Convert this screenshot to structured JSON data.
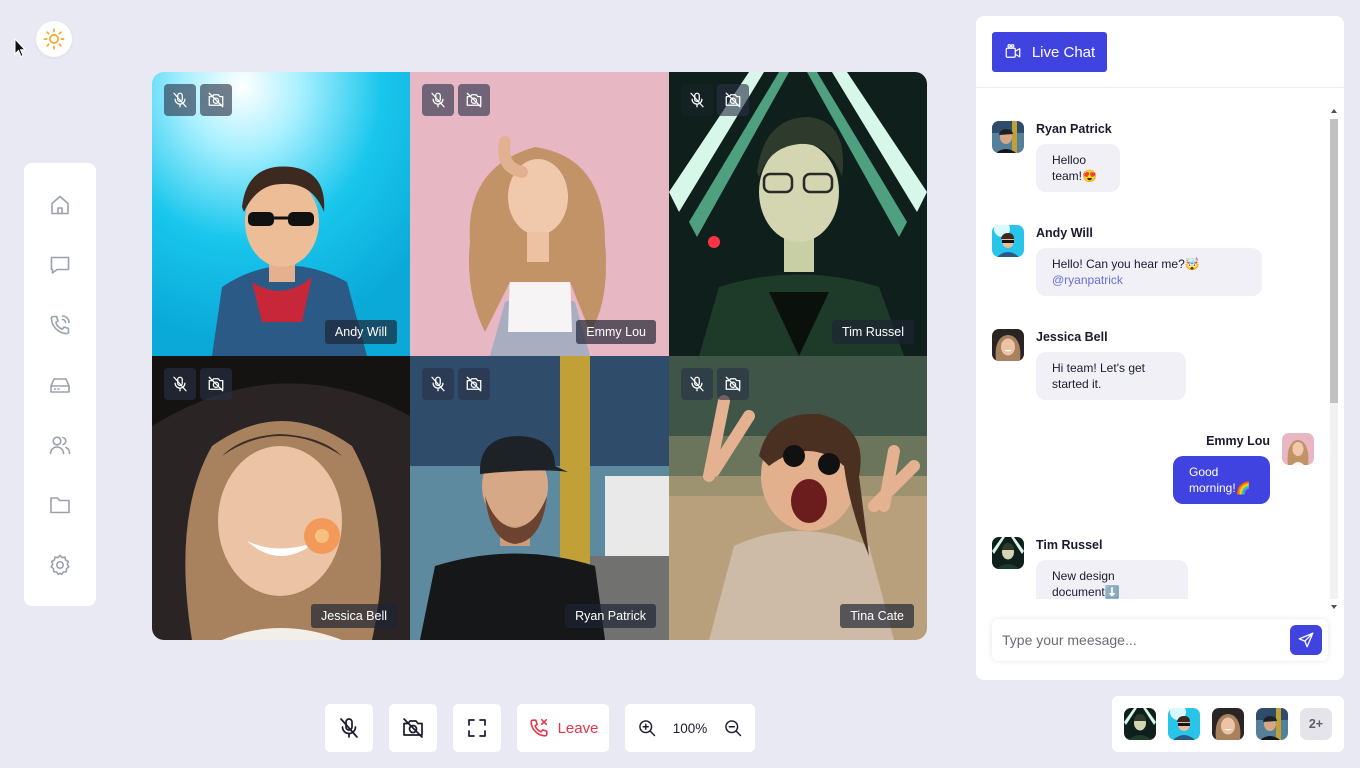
{
  "theme_icon": "sun-icon",
  "sidebar": {
    "items": [
      {
        "icon": "home-icon"
      },
      {
        "icon": "chat-bubble-icon"
      },
      {
        "icon": "phone-call-icon"
      },
      {
        "icon": "inbox-tray-icon"
      },
      {
        "icon": "users-icon"
      },
      {
        "icon": "folder-icon"
      },
      {
        "icon": "gear-icon"
      }
    ]
  },
  "video_tiles": [
    {
      "name": "Andy Will"
    },
    {
      "name": "Emmy Lou"
    },
    {
      "name": "Tim Russel"
    },
    {
      "name": "Jessica Bell"
    },
    {
      "name": "Ryan Patrick"
    },
    {
      "name": "Tina Cate"
    }
  ],
  "controls": {
    "leave_label": "Leave",
    "zoom_level": "100%"
  },
  "chat": {
    "header_button": "Live Chat",
    "messages": [
      {
        "author": "Ryan Patrick",
        "text": "Helloo team!😍"
      },
      {
        "author": "Andy Will",
        "text": "Hello! Can you hear me?🤯",
        "mention": "@ryanpatrick"
      },
      {
        "author": "Jessica Bell",
        "text": "Hi team! Let's get started it."
      },
      {
        "author": "Emmy Lou",
        "text": "Good morning!🌈"
      },
      {
        "author": "Tim Russel",
        "text": "New design document⬇️"
      }
    ],
    "input_placeholder": "Type your meesage..."
  },
  "participants": {
    "more_count": "2+"
  },
  "colors": {
    "accent": "#4043e0",
    "background": "#e9e9f4",
    "leave": "#e8334a"
  }
}
